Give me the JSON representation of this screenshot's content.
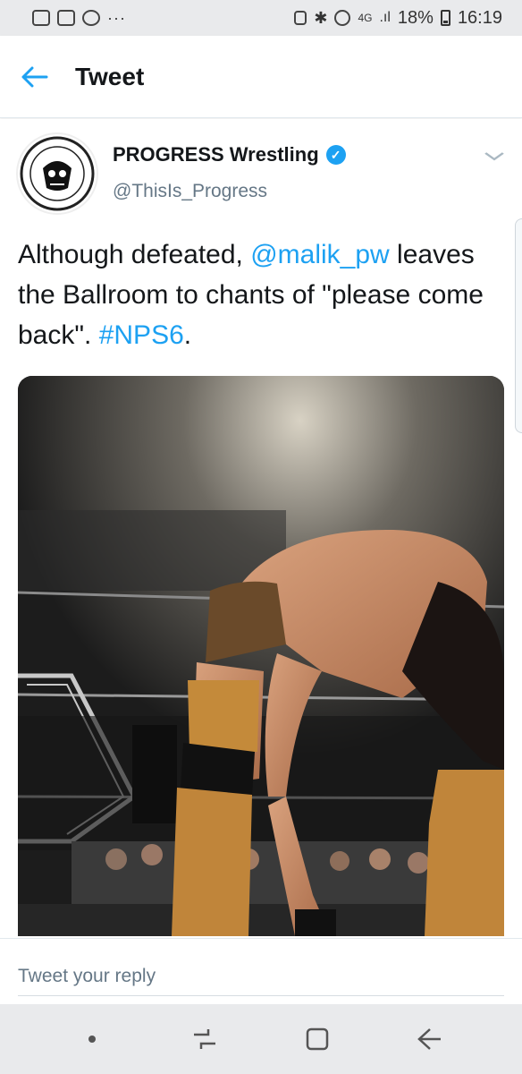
{
  "status_bar": {
    "network": "4G",
    "battery": "18%",
    "time": "16:19",
    "left_icons": [
      "instagram-icon",
      "gallery-icon",
      "whatsapp-icon",
      "more-dots-icon"
    ],
    "right_icons": [
      "lock-icon",
      "bluetooth-icon",
      "alarm-icon",
      "signal-icon",
      "battery-icon"
    ]
  },
  "app_bar": {
    "title": "Tweet",
    "back_icon": "back-arrow-icon"
  },
  "tweet": {
    "author_name": "PROGRESS Wrestling",
    "author_handle": "@ThisIs_Progress",
    "verified": true,
    "text_part1": "Although defeated, ",
    "mention": "@malik_pw",
    "text_part2": " leaves the Ballroom to chants of \"please come back\". ",
    "hashtag": "#NPS6",
    "text_end": "."
  },
  "reply": {
    "placeholder": "Tweet your reply"
  },
  "nav_bar": {
    "buttons": [
      "dot-icon",
      "recent-apps-icon",
      "home-icon",
      "back-icon"
    ]
  },
  "colors": {
    "accent": "#1da1f2",
    "text": "#14171a",
    "secondary": "#657786",
    "bars": "#e9eaec"
  }
}
